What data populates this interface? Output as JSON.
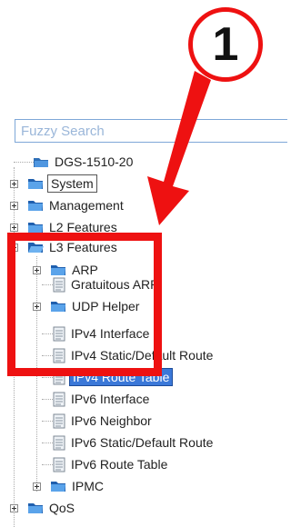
{
  "callout": {
    "number": "1",
    "color": "#ee1111"
  },
  "search": {
    "placeholder": "Fuzzy Search"
  },
  "tree": {
    "root": "DGS-1510-20",
    "items": [
      {
        "label": "System",
        "kind": "folder",
        "expander": "plus",
        "boxed": true
      },
      {
        "label": "Management",
        "kind": "folder",
        "expander": "plus"
      },
      {
        "label": "L2 Features",
        "kind": "folder",
        "expander": "plus"
      },
      {
        "label": "L3 Features",
        "kind": "folder",
        "expander": "minus"
      },
      {
        "label": "ARP",
        "kind": "folder",
        "expander": "plus"
      },
      {
        "label": "Gratuitous ARP",
        "kind": "page"
      },
      {
        "label": "UDP Helper",
        "kind": "folder",
        "expander": "plus"
      },
      {
        "label": "IPv4 Interface",
        "kind": "page"
      },
      {
        "label": "IPv4 Static/Default Route",
        "kind": "page"
      },
      {
        "label": "IPv4 Route Table",
        "kind": "page",
        "selected": true
      },
      {
        "label": "IPv6 Interface",
        "kind": "page"
      },
      {
        "label": "IPv6 Neighbor",
        "kind": "page"
      },
      {
        "label": "IPv6 Static/Default Route",
        "kind": "page"
      },
      {
        "label": "IPv6 Route Table",
        "kind": "page"
      },
      {
        "label": "IPMC",
        "kind": "folder",
        "expander": "plus"
      },
      {
        "label": "QoS",
        "kind": "folder",
        "expander": "plus"
      }
    ]
  }
}
